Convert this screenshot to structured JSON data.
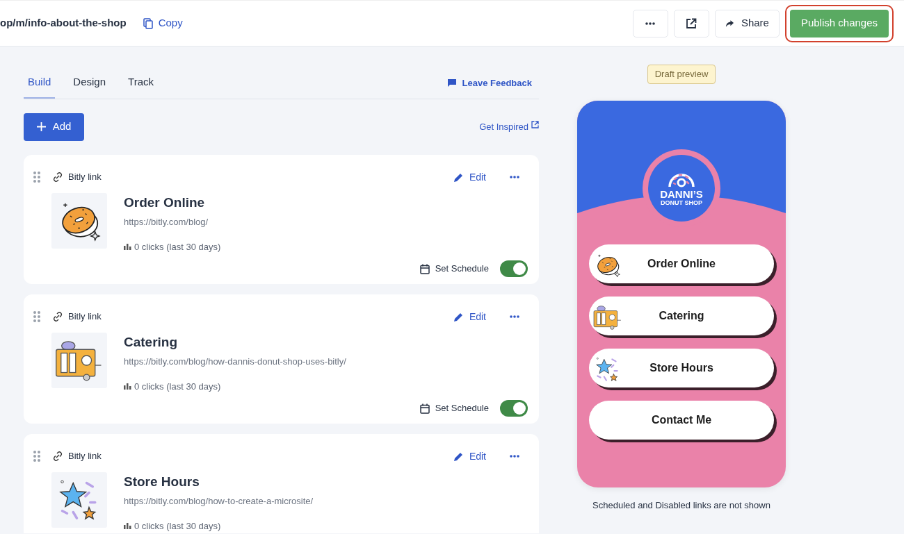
{
  "topbar": {
    "url": "op/m/info-about-the-shop",
    "copy": "Copy",
    "share": "Share",
    "publish": {
      "label": "Publish changes",
      "highlighted": true
    }
  },
  "tabs": [
    {
      "label": "Build",
      "selected": true
    },
    {
      "label": "Design",
      "selected": false
    },
    {
      "label": "Track",
      "selected": false
    }
  ],
  "feedback": "Leave Feedback",
  "add": "Add",
  "inspired": "Get Inspired",
  "links": [
    {
      "type": "Bitly link",
      "edit": "Edit",
      "title": "Order Online",
      "url": "https://bitly.com/blog/",
      "clicks": "0 clicks (last 30 days)",
      "kind": "donut",
      "schedule": "Set Schedule",
      "on": true
    },
    {
      "type": "Bitly link",
      "edit": "Edit",
      "title": "Catering",
      "url": "https://bitly.com/blog/how-dannis-donut-shop-uses-bitly/",
      "clicks": "0 clicks (last 30 days)",
      "kind": "truck",
      "schedule": "Set Schedule",
      "on": true
    },
    {
      "type": "Bitly link",
      "edit": "Edit",
      "title": "Store Hours",
      "url": "https://bitly.com/blog/how-to-create-a-microsite/",
      "clicks": "0 clicks (last 30 days)",
      "kind": "stars"
    }
  ],
  "preview": {
    "badge": "Draft preview",
    "logo_line1": "DANNI’S",
    "logo_line2": "DONUT SHOP",
    "buttons": [
      {
        "label": "Order Online",
        "kind": "donut"
      },
      {
        "label": "Catering",
        "kind": "truck"
      },
      {
        "label": "Store Hours",
        "kind": "stars"
      },
      {
        "label": "Contact Me"
      }
    ],
    "note": "Scheduled and Disabled links are not shown"
  }
}
